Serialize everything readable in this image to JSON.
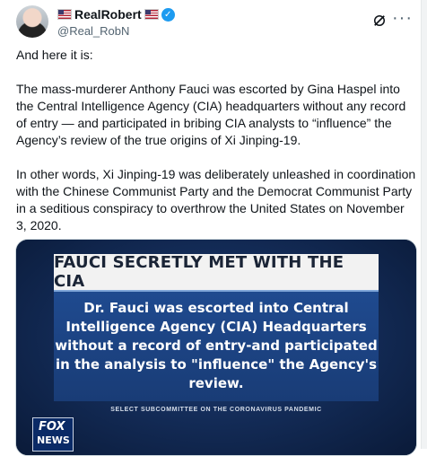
{
  "post": {
    "author_name": "RealRobert",
    "handle": "@Real_RobN",
    "icons": {
      "flag": "us-flag-icon",
      "verified": "verified-badge-icon",
      "grok": "grok-icon",
      "more": "more-icon"
    },
    "paragraphs": [
      "And here it is:",
      "The mass-murderer Anthony Fauci was escorted by Gina Haspel into the Central Intelligence Agency (CIA) headquarters without any record of entry — and participated in bribing CIA analysts to “influence” the Agency’s review of the true origins of Xi Jinping-19.",
      "In other words, Xi Jinping-19 was deliberately unleashed in coordination with the Chinese Communist Party and the Democrat Communist Party in a seditious conspiracy to overthrow the United States on November 3, 2020."
    ],
    "verified_mark": "✓",
    "more_glyph": "···"
  },
  "media": {
    "headline": "FAUCI SECRETLY MET WITH THE CIA",
    "quote": "Dr. Fauci was escorted into Central Intelligence Agency (CIA) Headquarters without a record of entry-and participated in the analysis to \"influence\" the Agency's review.",
    "subcaption": "SELECT SUBCOMMITTEE ON THE CORONAVIRUS PANDEMIC",
    "logo_top": "FOX",
    "logo_bottom": "NEWS"
  },
  "colors": {
    "verified": "#1d9bf0",
    "handle": "#536471",
    "media_blue": "#1f4a8f"
  }
}
